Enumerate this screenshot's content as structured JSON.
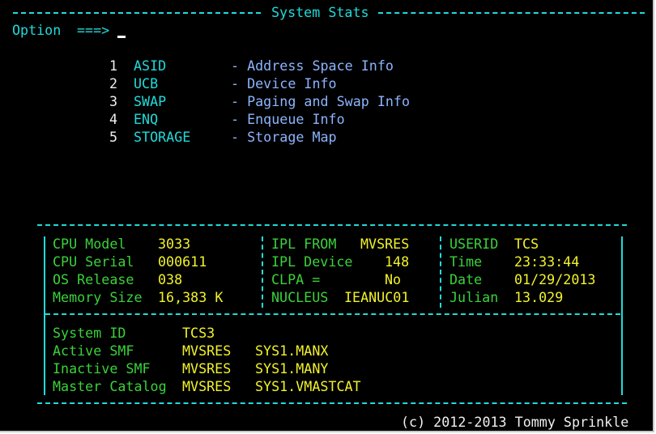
{
  "header": {
    "title": "System Stats",
    "option_label": "Option",
    "option_arrow": "===>",
    "option_value": ""
  },
  "menu": [
    {
      "num": "1",
      "cmd": "ASID",
      "desc": "- Address Space Info"
    },
    {
      "num": "2",
      "cmd": "UCB",
      "desc": "- Device Info"
    },
    {
      "num": "3",
      "cmd": "SWAP",
      "desc": "- Paging and Swap Info"
    },
    {
      "num": "4",
      "cmd": "ENQ",
      "desc": "- Enqueue Info"
    },
    {
      "num": "5",
      "cmd": "STORAGE",
      "desc": "- Storage Map"
    }
  ],
  "stats": {
    "cpu": [
      {
        "label": "CPU Model",
        "value": "3033"
      },
      {
        "label": "CPU Serial",
        "value": "000611"
      },
      {
        "label": "OS Release",
        "value": "038"
      },
      {
        "label": "Memory Size",
        "value": "16,383 K"
      }
    ],
    "ipl": [
      {
        "label": "IPL FROM",
        "value": "MVSRES"
      },
      {
        "label": "IPL Device",
        "value": "148"
      },
      {
        "label": "CLPA =",
        "value": "No"
      },
      {
        "label": "NUCLEUS",
        "value": "IEANUC01"
      }
    ],
    "user": [
      {
        "label": "USERID",
        "value": "TCS"
      },
      {
        "label": "Time",
        "value": "23:33:44"
      },
      {
        "label": "Date",
        "value": "01/29/2013"
      },
      {
        "label": "Julian",
        "value": "13.029"
      }
    ]
  },
  "system": {
    "system_id_label": "System ID",
    "system_id_value": "TCS3",
    "rows": [
      {
        "label": "Active SMF",
        "volume": "MVSRES",
        "dataset": "SYS1.MANX"
      },
      {
        "label": "Inactive SMF",
        "volume": "MVSRES",
        "dataset": "SYS1.MANY"
      },
      {
        "label": "Master Catalog",
        "volume": "MVSRES",
        "dataset": "SYS1.VMASTCAT"
      }
    ]
  },
  "footer": {
    "copyright": "(c) 2012-2013 Tommy Sprinkle"
  },
  "colors": {
    "background": "#000000",
    "border": "#22dada",
    "menu_text": "#8cb4ff",
    "label": "#3ad23a",
    "value": "#f2f22a",
    "footer": "#f0f0f0"
  }
}
